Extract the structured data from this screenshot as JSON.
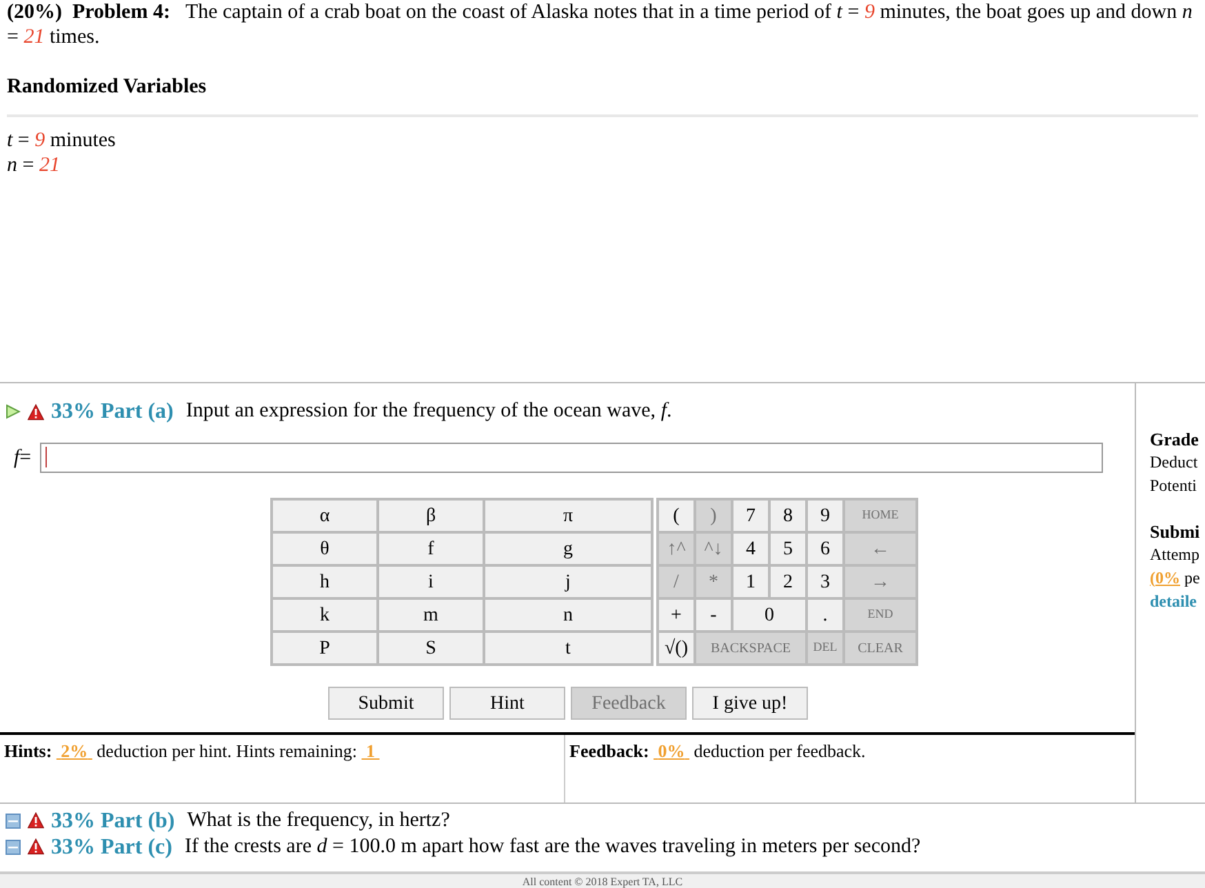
{
  "problem": {
    "percent": "(20%)",
    "label": "Problem 4:",
    "segments": [
      {
        "kind": "plain",
        "text": "The captain of a crab boat on the coast of Alaska notes that in a time period of "
      },
      {
        "kind": "var",
        "text": "t"
      },
      {
        "kind": "plain",
        "text": " = "
      },
      {
        "kind": "value",
        "text": "9"
      },
      {
        "kind": "plain",
        "text": " minutes, the boat goes up and down "
      },
      {
        "kind": "var",
        "text": "n"
      },
      {
        "kind": "plain",
        "text": " = "
      },
      {
        "kind": "value",
        "text": "21"
      },
      {
        "kind": "plain",
        "text": " times."
      }
    ]
  },
  "randomized": {
    "title": "Randomized Variables",
    "variables": [
      {
        "name": "t",
        "equals": "=",
        "value": "9",
        "unit": "minutes"
      },
      {
        "name": "n",
        "equals": "=",
        "value": "21"
      }
    ]
  },
  "part_a": {
    "percent": "33% Part (a)",
    "question": "Input an expression for the frequency of the ocean wave, ",
    "symbol": "f",
    "suffix": ".",
    "answer_label": "f",
    "equals": "="
  },
  "side": {
    "grade_title": "Grade",
    "grade_lines": [
      "Deduct",
      "Potenti"
    ],
    "submit_title": "Submi",
    "submit_lines": [
      "Attemp"
    ],
    "percent": "(0%",
    "percent_rest": " pe",
    "link": "detaile"
  },
  "symbols": [
    "α",
    "β",
    "π",
    "θ",
    "f",
    "g",
    "h",
    "i",
    "j",
    "k",
    "m",
    "n",
    "P",
    "S",
    "t"
  ],
  "keys": [
    {
      "kind": "single",
      "label": "(",
      "disabled": false
    },
    {
      "kind": "single",
      "label": ")",
      "disabled": true
    },
    {
      "kind": "single",
      "label": "7",
      "disabled": false
    },
    {
      "kind": "single",
      "label": "8",
      "disabled": false
    },
    {
      "kind": "single",
      "label": "9",
      "disabled": false
    },
    {
      "kind": "single",
      "label": "HOME",
      "disabled": true
    },
    {
      "kind": "single",
      "label": "↑^",
      "disabled": true
    },
    {
      "kind": "single",
      "label": "^↓",
      "disabled": true
    },
    {
      "kind": "single",
      "label": "4",
      "disabled": false
    },
    {
      "kind": "single",
      "label": "5",
      "disabled": false
    },
    {
      "kind": "single",
      "label": "6",
      "disabled": false
    },
    {
      "kind": "single",
      "label": "←",
      "disabled": true
    },
    {
      "kind": "single",
      "label": "/",
      "disabled": true
    },
    {
      "kind": "single",
      "label": "*",
      "disabled": true
    },
    {
      "kind": "single",
      "label": "1",
      "disabled": false
    },
    {
      "kind": "single",
      "label": "2",
      "disabled": false
    },
    {
      "kind": "single",
      "label": "3",
      "disabled": false
    },
    {
      "kind": "single",
      "label": "→",
      "disabled": true
    },
    {
      "kind": "single",
      "label": "+",
      "disabled": false
    },
    {
      "kind": "single",
      "label": "-",
      "disabled": false
    },
    {
      "kind": "double",
      "label": "0",
      "disabled": false
    },
    {
      "kind": "single",
      "label": ".",
      "disabled": false
    },
    {
      "kind": "single",
      "label": "END",
      "disabled": true
    },
    {
      "kind": "single",
      "label": "√()",
      "disabled": false
    },
    {
      "kind": "triple",
      "label": "BACKSPACE",
      "disabled": true
    },
    {
      "kind": "single",
      "label": "DEL",
      "disabled": true
    },
    {
      "kind": "single",
      "label": "CLEAR",
      "disabled": true
    }
  ],
  "buttons": [
    {
      "label": "Submit",
      "disabled": false
    },
    {
      "label": "Hint",
      "disabled": false
    },
    {
      "label": "Feedback",
      "disabled": true
    },
    {
      "label": "I give up!",
      "disabled": false
    }
  ],
  "hints": {
    "title": "Hints:",
    "deduction": "2%",
    "text": "deduction per hint. Hints remaining:",
    "remaining": "1"
  },
  "feedback": {
    "title": "Feedback:",
    "deduction": "0%",
    "text": "deduction per feedback."
  },
  "other_parts": [
    {
      "percent": "33% Part (b)",
      "segments": [
        {
          "kind": "plain",
          "text": "What is the frequency, in hertz?"
        }
      ]
    },
    {
      "percent": "33% Part (c)",
      "segments": [
        {
          "kind": "plain",
          "text": "If the crests are "
        },
        {
          "kind": "var",
          "text": "d"
        },
        {
          "kind": "plain",
          "text": " = 100.0 m apart how fast are the waves traveling in meters per second?"
        }
      ]
    }
  ],
  "footer": "All content © 2018 Expert TA, LLC"
}
